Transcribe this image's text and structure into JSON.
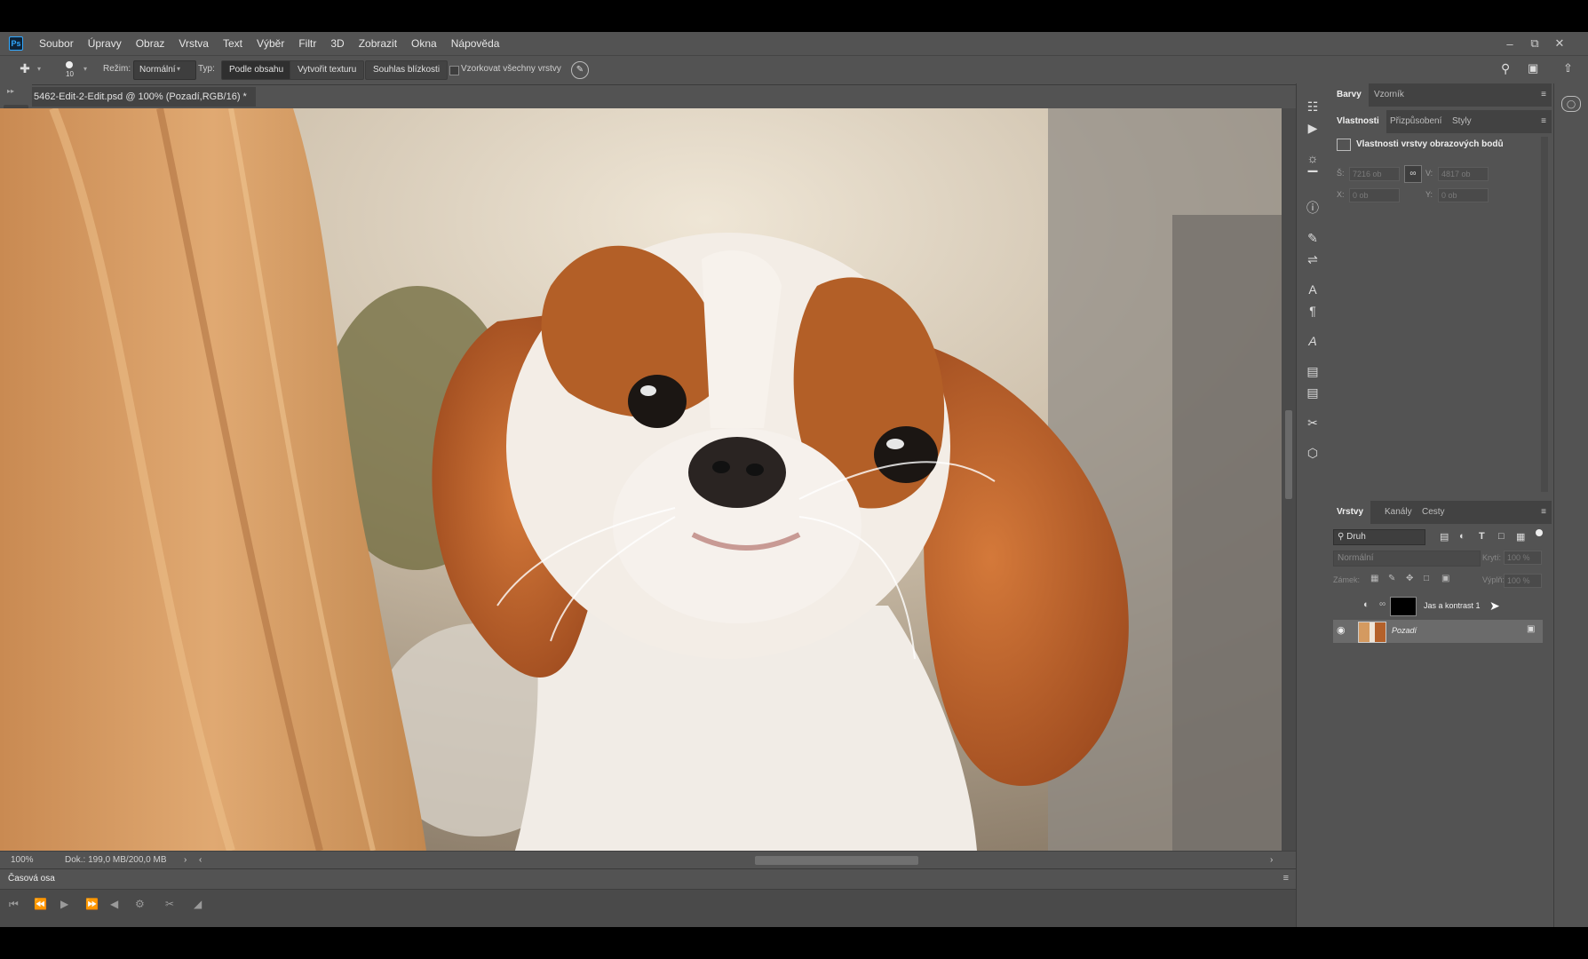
{
  "app": {
    "logo": "Ps",
    "menu": [
      "Soubor",
      "Úpravy",
      "Obraz",
      "Vrstva",
      "Text",
      "Výběr",
      "Filtr",
      "3D",
      "Zobrazit",
      "Okna",
      "Nápověda"
    ]
  },
  "options": {
    "brush_size": "10",
    "mode_label": "Režim:",
    "mode_value": "Normální",
    "type_label": "Typ:",
    "type_buttons": [
      "Podle obsahu",
      "Vytvořit texturu",
      "Souhlas blízkosti"
    ],
    "sample_all_label": "Vzorkovat všechny vrstvy"
  },
  "document": {
    "tab_title": "5462-Edit-2-Edit.psd @ 100% (Pozadí,RGB/16) *",
    "zoom": "100%",
    "doc_size": "Dok.: 199,0 MB/200,0 MB"
  },
  "timeline": {
    "title": "Časová osa"
  },
  "panels": {
    "top_tabs": [
      "Barvy",
      "Vzorník"
    ],
    "prop_tabs": [
      "Vlastnosti",
      "Přizpůsobení",
      "Styly"
    ],
    "prop_title": "Vlastnosti vrstvy obrazových bodů",
    "w_label": "Š:",
    "w_value": "7216 ob",
    "h_label": "V:",
    "h_value": "4817 ob",
    "x_label": "X:",
    "x_value": "0 ob",
    "y_label": "Y:",
    "y_value": "0 ob",
    "layer_tabs": [
      "Vrstvy",
      "Kanály",
      "Cesty"
    ],
    "filter_kind": "Druh",
    "blend_mode": "Normální",
    "opacity_label": "Krytí:",
    "opacity_value": "100 %",
    "lock_label": "Zámek:",
    "fill_label": "Výplň:",
    "fill_value": "100 %",
    "layers": [
      {
        "name": "Jas a kontrast 1",
        "visible": false
      },
      {
        "name": "Pozadí",
        "visible": true
      }
    ]
  },
  "icons": {
    "tools": [
      "move-icon",
      "marquee-icon",
      "lasso-icon",
      "magic-wand-icon",
      "crop-icon",
      "eyedropper-icon",
      "healing-brush-icon",
      "brush-icon",
      "stamp-icon",
      "history-brush-icon",
      "eraser-icon",
      "paint-bucket-icon",
      "smudge-icon",
      "dodge-icon",
      "pen-icon",
      "type-icon",
      "path-select-icon",
      "line-icon",
      "hand-icon",
      "zoom-icon",
      "more-icon"
    ]
  }
}
